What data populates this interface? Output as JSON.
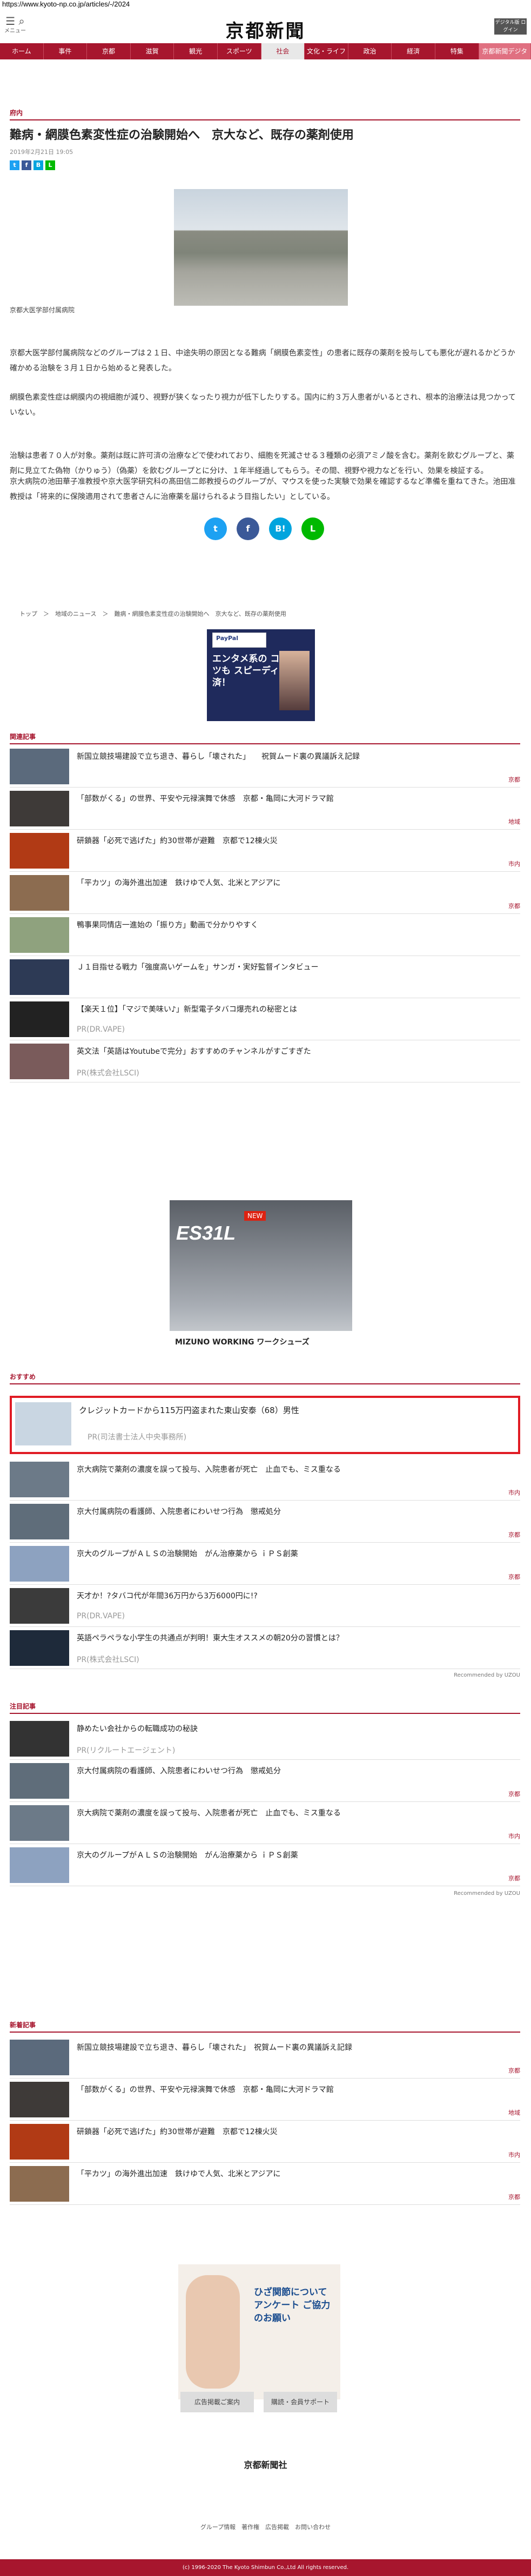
{
  "url": "https://www.kyoto-np.co.jp/articles/-/2024",
  "header": {
    "menu_label": "メニュー",
    "search_label": "検索",
    "logo": "京都新聞",
    "right_box": "デジタル版 ログイン"
  },
  "nav": [
    "ホーム",
    "事件",
    "京都",
    "滋賀",
    "観光",
    "スポーツ",
    "社会",
    "文化・ライフ",
    "政治",
    "経済",
    "特集",
    "京都新聞デジタル"
  ],
  "article": {
    "section": "府内",
    "title": "難病・網膜色素変性症の治験開始へ　京大など、既存の薬剤使用",
    "date": "2019年2月21日 19:05",
    "caption": "京都大医学部付属病院",
    "p1": "京都大医学部付属病院などのグループは２１日、中途失明の原因となる難病「網膜色素変性」の患者に既存の薬剤を投与しても悪化が遅れるかどうか確かめる治験を３月１日から始めると発表した。",
    "p2": "網膜色素変性症は網膜内の視細胞が減り、視野が狭くなったり視力が低下したりする。国内に約３万人患者がいるとされ、根本的治療法は見つかっていない。",
    "p3": "治験は患者７０人が対象。薬剤は既に許可済の治療などで使われており、細胞を死滅させる３種類の必須アミノ酸を含む。薬剤を飲むグループと、薬剤に見立てた偽物（かりゅう）（偽薬）を飲むグループとに分け、１年半経過してもらう。その間、視野や視力などを行い、効果を検証する。",
    "p4": "京大病院の池田華子准教授や京大医学研究科の髙田信二郎教授らのグループが、マウスを使った実験で効果を確認するなど準備を重ねてきた。池田准教授は「将来的に保険適用されて患者さんに治療薬を届けられるよう目指したい」としている。",
    "breadcrumb": "トップ　＞　地域のニュース　＞　難病・網膜色素変性症の治験開始へ　京大など、既存の薬剤使用"
  },
  "ads": {
    "paypal_label": "PayPal",
    "paypal_text": "エンタメ系の コンテンツも スピーディー決済！",
    "shoe_name": "ES31L",
    "shoe_new": "NEW",
    "shoe_brand": "MIZUNO WORKING ワークシューズ",
    "survey": "ひざ関節について アンケート ご協力のお願い"
  },
  "related": {
    "heading": "関連記事",
    "items": [
      {
        "text": "新国立競技場建設で立ち退き、暮らし「壊された」　　祝賀ムード裏の異議訴え記録",
        "tag": "京都"
      },
      {
        "text": "「部数がくる」の世界、平安や元禄演舞で休感　京都・亀岡に大河ドラマ館",
        "tag": "地域"
      },
      {
        "text": "研鎖器「必死で逃げた」約30世帯が避難　京都で12棟火災",
        "tag": "市内"
      },
      {
        "text": "「平カツ」の海外進出加速　鉄けゆで人気、北米とアジアに",
        "tag": "京都"
      },
      {
        "text": "鴨事果同情店一進始の「振り方」動画で分かりやすく",
        "tag": ""
      },
      {
        "text": "Ｊ１目指せる戦力「強度高いゲームを」サンガ・実好監督インタビュー",
        "tag": ""
      },
      {
        "text": "【楽天１位】「マジで美味い♪」新型電子タバコ爆売れの秘密とは",
        "pr": "PR(DR.VAPE)"
      },
      {
        "text": "英文法「英語はYoutubeで完分」おすすめのチャンネルがすごすぎた",
        "pr": "PR(株式会社LSCI)"
      }
    ]
  },
  "recommend": {
    "heading": "おすすめ",
    "items": [
      {
        "text": "クレジットカードから115万円盗まれた東山安泰（68）男性",
        "pr": "PR(司法書士法人中央事務所)"
      },
      {
        "text": "京大病院で薬剤の濃度を誤って投与、入院患者が死亡　止血でも、ミス重なる",
        "tag": "市内"
      },
      {
        "text": "京大付属病院の看護師、入院患者にわいせつ行為　懲戒処分",
        "tag": "京都"
      },
      {
        "text": "京大のグループがＡＬＳの治験開始　がん治療薬から ｉＰＳ創薬",
        "tag": "京都"
      },
      {
        "text": "天才か！?タバコ代が年間36万円から3万6000円に!?",
        "pr": "PR(DR.VAPE)"
      },
      {
        "text": "英語ペラペラな小学生の共通点が判明！東大生オススメの朝20分の習慣とは？",
        "pr": "PR(株式会社LSCI)"
      }
    ],
    "by": "Recommended by UZOU"
  },
  "attention": {
    "heading": "注目記事",
    "items": [
      {
        "text": "静めたい会社からの転職成功の秘訣",
        "pr": "PR(リクルートエージェント)"
      },
      {
        "text": "京大付属病院の看護師、入院患者にわいせつ行為　懲戒処分",
        "tag": "京都"
      },
      {
        "text": "京大病院で薬剤の濃度を誤って投与、入院患者が死亡　止血でも、ミス重なる",
        "tag": "市内"
      },
      {
        "text": "京大のグループがＡＬＳの治験開始　がん治療薬から ｉＰＳ創薬",
        "tag": "京都"
      }
    ],
    "by": "Recommended by UZOU"
  },
  "latest": {
    "heading": "新着記事",
    "items": [
      {
        "text": "新国立競技場建設で立ち退き、暮らし「壊された」　祝賀ムード裏の異議訴え記録",
        "tag": "京都"
      },
      {
        "text": "「部数がくる」の世界、平安や元禄演舞で休感　京都・亀岡に大河ドラマ館",
        "tag": "地域"
      },
      {
        "text": "研鎖器「必死で逃げた」約30世帯が避難　京都で12棟火災",
        "tag": "市内"
      },
      {
        "text": "「平カツ」の海外進出加速　鉄けゆで人気、北米とアジアに",
        "tag": "京都"
      }
    ]
  },
  "footer": {
    "btn1": "広告掲載ご案内",
    "btn2": "購読・会員サポート",
    "company": "京都新聞社",
    "links": "グループ情報　著作権　広告掲載　お問い合わせ",
    "copyright": "(c) 1996-2020 The Kyoto Shimbun Co.,Ltd All rights reserved."
  }
}
